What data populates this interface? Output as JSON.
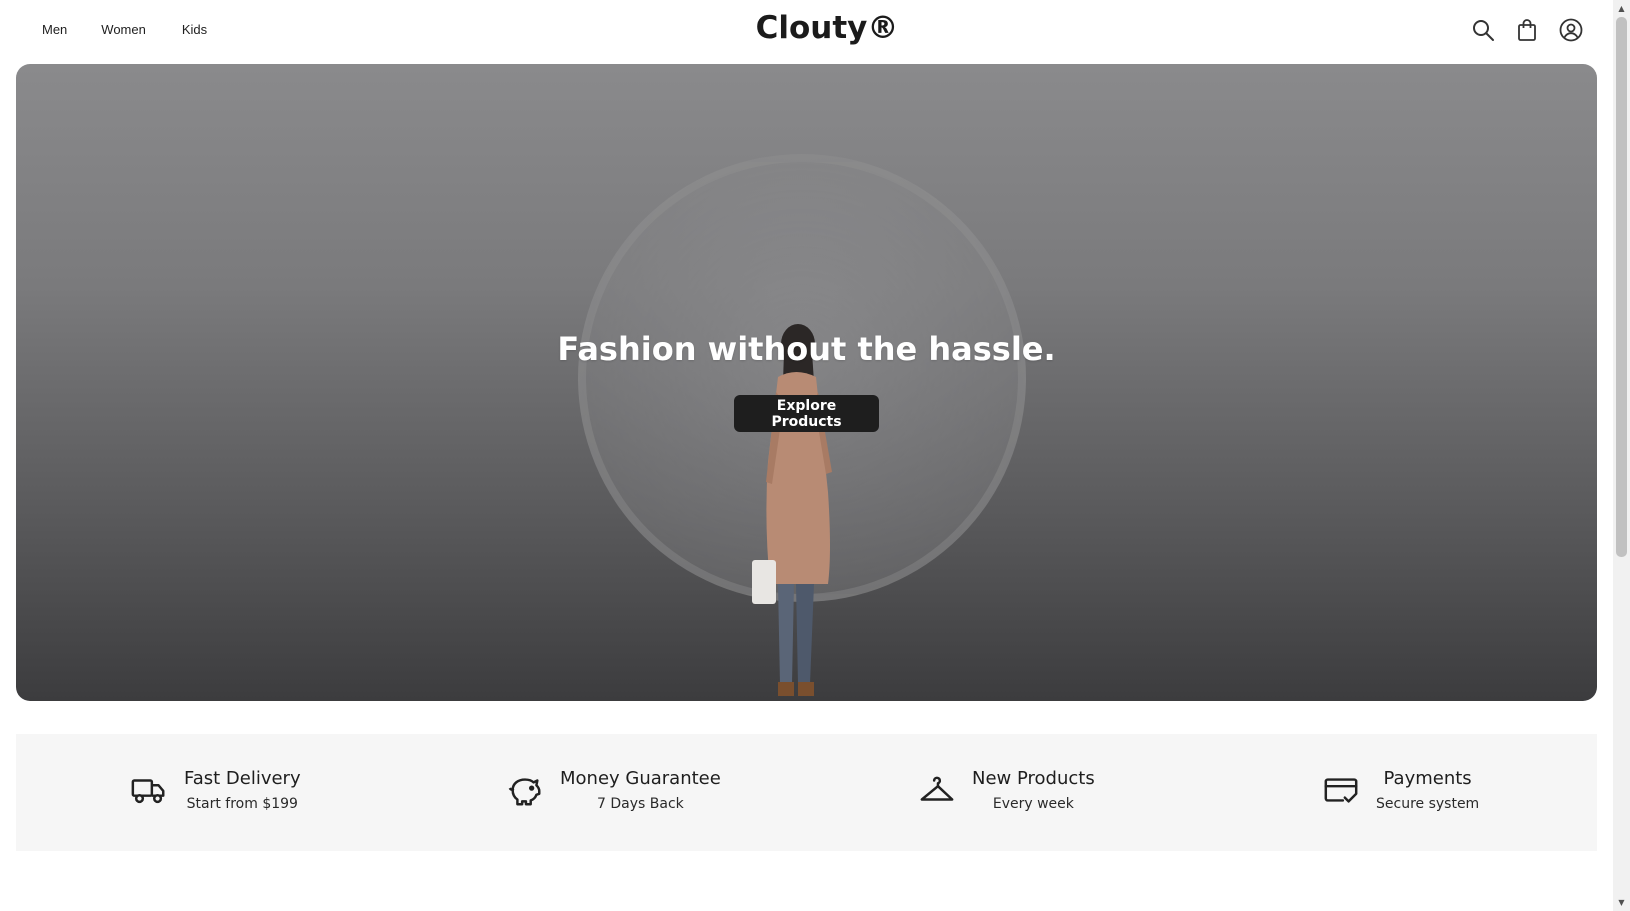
{
  "header": {
    "nav": [
      "Men",
      "Women",
      "Kids"
    ],
    "logo": "Clouty®",
    "icons": [
      "search-icon",
      "shopping-bag-icon",
      "account-icon"
    ]
  },
  "hero": {
    "title": "Fashion without the hassle.",
    "cta": "Explore Products"
  },
  "features": [
    {
      "icon": "truck-icon",
      "title": "Fast Delivery",
      "subtitle": "Start from $199"
    },
    {
      "icon": "piggy-bank-icon",
      "title": "Money Guarantee",
      "subtitle": "7 Days Back"
    },
    {
      "icon": "hanger-icon",
      "title": "New Products",
      "subtitle": "Every week"
    },
    {
      "icon": "credit-card-check-icon",
      "title": "Payments",
      "subtitle": "Secure system"
    }
  ],
  "colors": {
    "button_bg": "#1e1e1e",
    "feature_bg": "#f6f6f6"
  }
}
